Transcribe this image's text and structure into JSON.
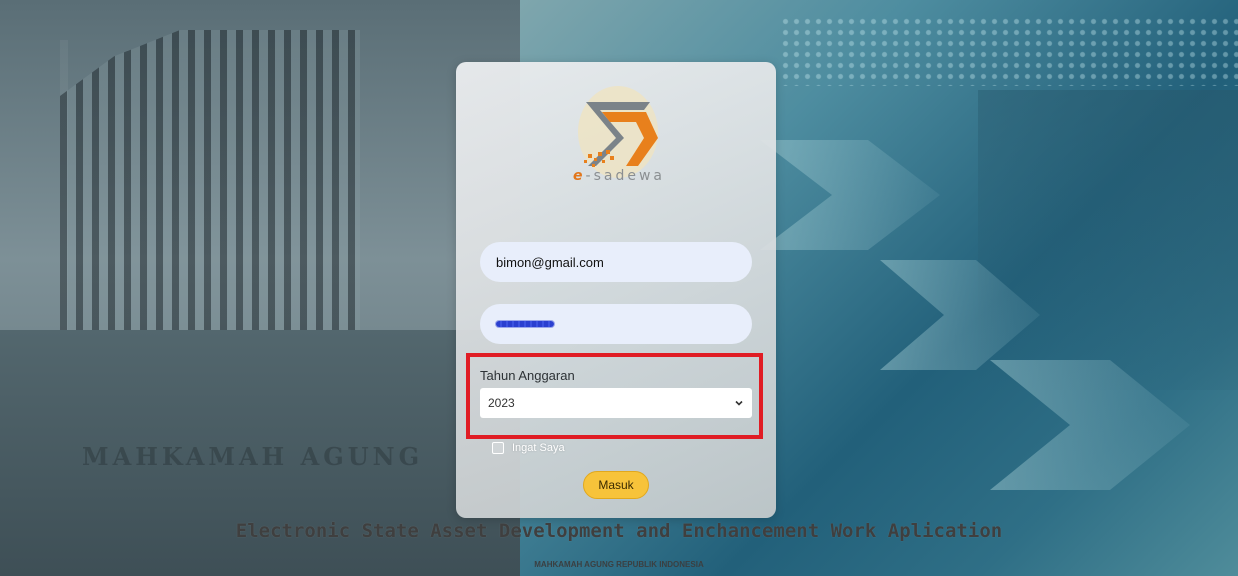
{
  "brand": {
    "logo_prefix": "e",
    "logo_suffix": "-sadewa",
    "accent_color": "#e2761b"
  },
  "login": {
    "email_value": "bimon@gmail.com",
    "password_masked": true,
    "year_label": "Tahun Anggaran",
    "year_value": "2023",
    "remember_label": "Ingat Saya",
    "submit_label": "Masuk"
  },
  "footer": {
    "tagline": "Electronic State Asset Development and Enchancement Work Aplication",
    "org": "MAHKAMAH AGUNG REPUBLIK INDONESIA",
    "bg_wordmark": "MAHKAMAH AGUNG"
  },
  "colors": {
    "submit": "#f7c33a",
    "highlight": "#e01c24"
  }
}
